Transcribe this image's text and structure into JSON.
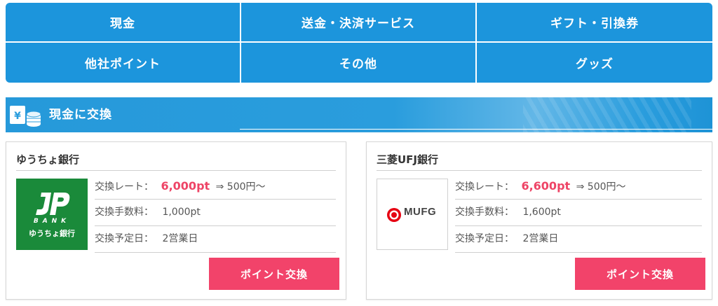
{
  "categories": [
    {
      "label": "現金"
    },
    {
      "label": "送金・決済サービス"
    },
    {
      "label": "ギフト・引換券"
    },
    {
      "label": "他社ポイント"
    },
    {
      "label": "その他"
    },
    {
      "label": "グッズ"
    }
  ],
  "section": {
    "title": "現金に交換"
  },
  "banks": [
    {
      "name": "ゆうちょ銀行",
      "logo_bank_text": "BANK",
      "logo_name_text": "ゆうちょ銀行",
      "rate_label": "交換レート：",
      "rate_value": "6,000pt",
      "rate_tail": "⇒ 500円～",
      "fee_label": "交換手数料：",
      "fee_value": "1,000pt",
      "date_label": "交換予定日：",
      "date_value": "2営業日",
      "button_label": "ポイント交換"
    },
    {
      "name": "三菱UFJ銀行",
      "logo_text": "MUFG",
      "rate_label": "交換レート：",
      "rate_value": "6,600pt",
      "rate_tail": "⇒ 500円～",
      "fee_label": "交換手数料：",
      "fee_value": "1,600pt",
      "date_label": "交換予定日：",
      "date_value": "2営業日",
      "button_label": "ポイント交換"
    }
  ],
  "colors": {
    "nav_blue": "#1c95dc",
    "accent_pink": "#f2436a",
    "rate_red": "#ee4466",
    "jp_green": "#1a8a3a",
    "mufg_red": "#e60012"
  }
}
